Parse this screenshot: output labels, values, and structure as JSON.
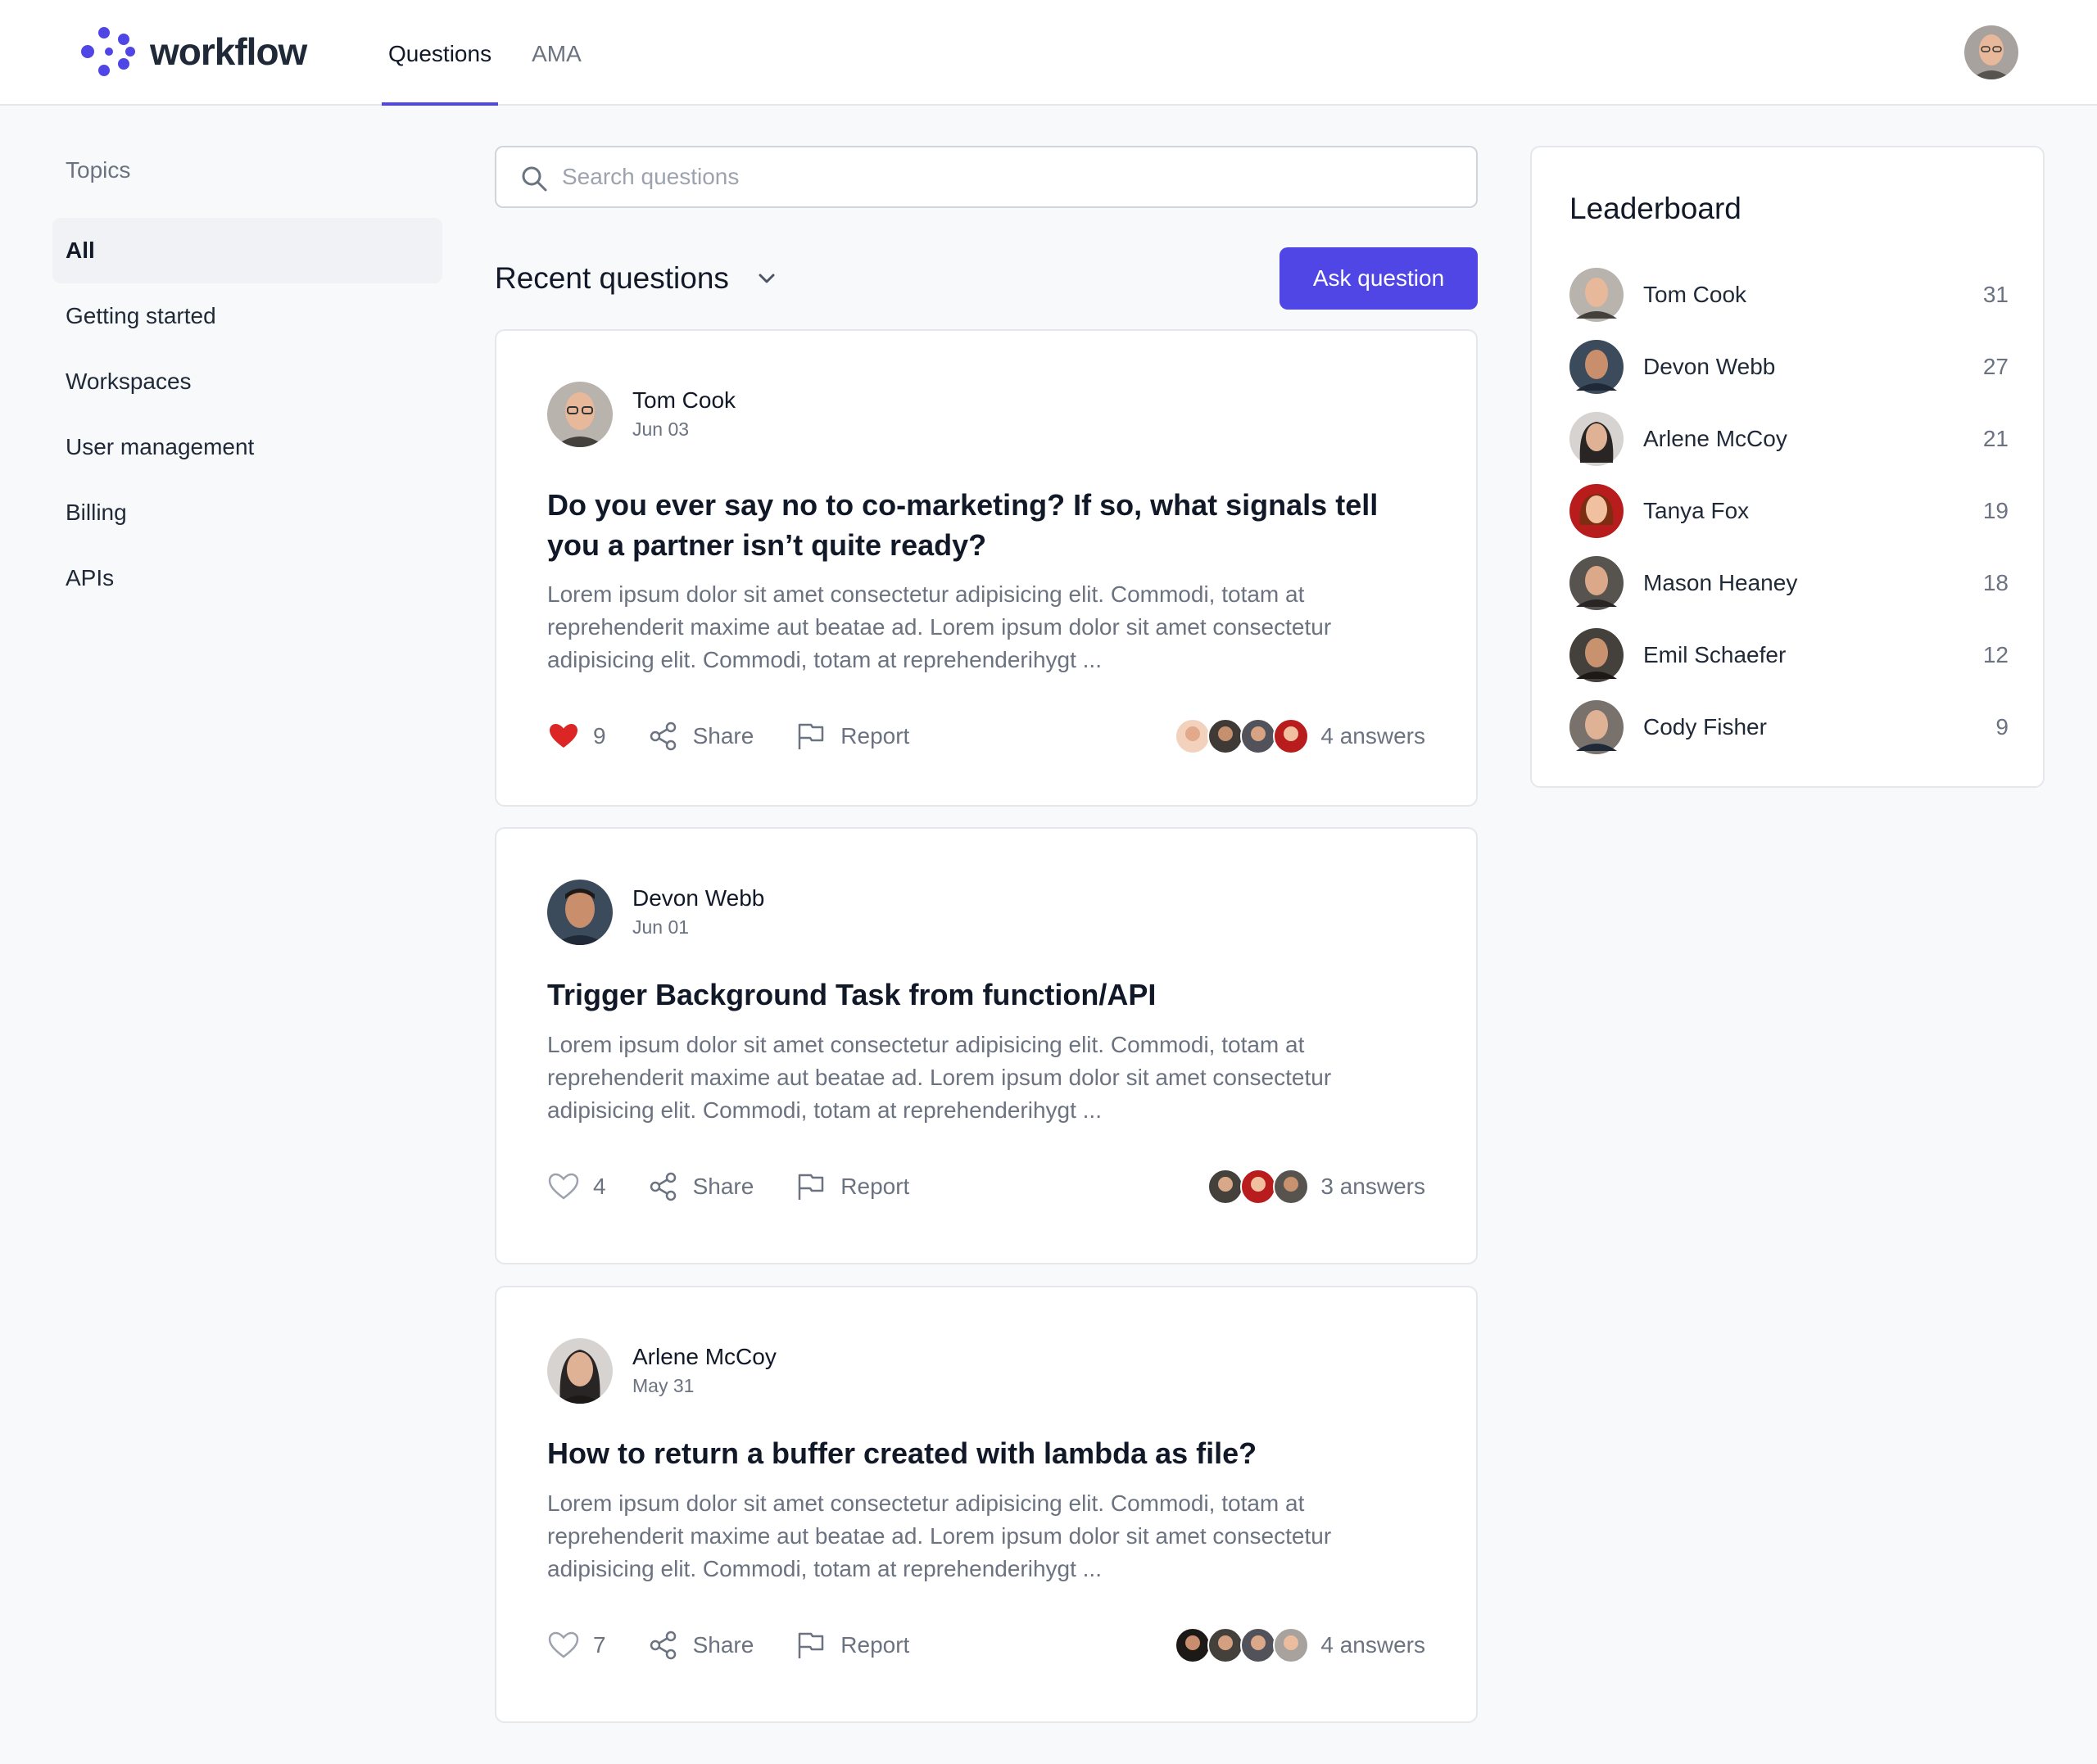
{
  "brand": {
    "name": "workflow",
    "accent_color": "#4f46e5"
  },
  "header": {
    "tabs": [
      {
        "label": "Questions",
        "active": true
      },
      {
        "label": "AMA",
        "active": false
      }
    ],
    "user_avatar": "user-avatar"
  },
  "sidebar": {
    "title": "Topics",
    "items": [
      {
        "label": "All",
        "active": true
      },
      {
        "label": "Getting started",
        "active": false
      },
      {
        "label": "Workspaces",
        "active": false
      },
      {
        "label": "User management",
        "active": false
      },
      {
        "label": "Billing",
        "active": false
      },
      {
        "label": "APIs",
        "active": false
      }
    ]
  },
  "search": {
    "placeholder": "Search questions",
    "value": "",
    "icon": "search-icon"
  },
  "list": {
    "heading": "Recent questions",
    "sort_icon": "chevron-down-icon",
    "ask_button": "Ask question"
  },
  "questions": [
    {
      "author": "Tom Cook",
      "date": "Jun 03",
      "title": "Do you ever say no to co-marketing? If so, what signals tell you a partner isn’t quite ready?",
      "body": "Lorem ipsum dolor sit amet consectetur adipisicing elit. Commodi, totam at reprehenderit maxime aut beatae ad. Lorem ipsum dolor sit amet consectetur adipisicing elit. Commodi, totam at reprehenderihygt ...",
      "likes": "9",
      "liked": true,
      "share_label": "Share",
      "report_label": "Report",
      "answers_label": "4 answers"
    },
    {
      "author": "Devon Webb",
      "date": "Jun 01",
      "title": "Trigger Background Task from function/API",
      "body": "Lorem ipsum dolor sit amet consectetur adipisicing elit. Commodi, totam at reprehenderit maxime aut beatae ad. Lorem ipsum dolor sit amet consectetur adipisicing elit. Commodi, totam at reprehenderihygt ...",
      "likes": "4",
      "liked": false,
      "share_label": "Share",
      "report_label": "Report",
      "answers_label": "3 answers"
    },
    {
      "author": "Arlene McCoy",
      "date": "May 31",
      "title": "How to return a buffer created with lambda as file?",
      "body": "Lorem ipsum dolor sit amet consectetur adipisicing elit. Commodi, totam at reprehenderit maxime aut beatae ad. Lorem ipsum dolor sit amet consectetur adipisicing elit. Commodi, totam at reprehenderihygt ...",
      "likes": "7",
      "liked": false,
      "share_label": "Share",
      "report_label": "Report",
      "answers_label": "4 answers"
    }
  ],
  "leaderboard": {
    "title": "Leaderboard",
    "entries": [
      {
        "name": "Tom Cook",
        "score": "31"
      },
      {
        "name": "Devon Webb",
        "score": "27"
      },
      {
        "name": "Arlene McCoy",
        "score": "21"
      },
      {
        "name": "Tanya Fox",
        "score": "19"
      },
      {
        "name": "Mason Heaney",
        "score": "18"
      },
      {
        "name": "Emil Schaefer",
        "score": "12"
      },
      {
        "name": "Cody Fisher",
        "score": "9"
      }
    ]
  },
  "colors": {
    "heart_filled": "#dc2626",
    "icon_gray": "#9ca3af",
    "background": "#f8f9fb"
  }
}
